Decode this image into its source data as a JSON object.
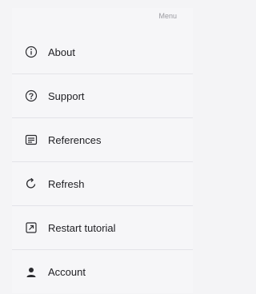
{
  "menu": {
    "title": "Menu",
    "items": [
      {
        "label": "About",
        "icon": "info-circle-icon"
      },
      {
        "label": "Support",
        "icon": "question-circle-icon"
      },
      {
        "label": "References",
        "icon": "list-box-icon"
      },
      {
        "label": "Refresh",
        "icon": "refresh-icon"
      },
      {
        "label": "Restart tutorial",
        "icon": "external-link-box-icon"
      },
      {
        "label": "Account",
        "icon": "person-icon"
      }
    ]
  }
}
